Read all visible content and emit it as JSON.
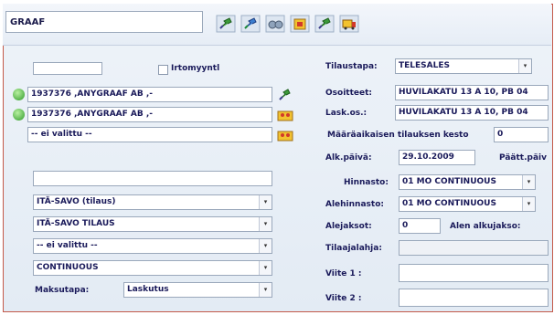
{
  "header": {
    "customer": "GRAAF",
    "toolbar_icons": [
      "pin-green-icon",
      "pin-blue-icon",
      "binoculars-icon",
      "folder-icon",
      "pin-green-2-icon",
      "truck-icon"
    ]
  },
  "left": {
    "top_field": "",
    "checkbox_label": "Irtomyyntl",
    "customer1": "1937376 ,ANYGRAAF AB ,-",
    "customer2": "1937376 ,ANYGRAAF AB ,-",
    "customer3": "-- ei valittu --",
    "blank_field": "",
    "select1": "ITÄ-SAVO (tilaus)",
    "select2": "ITÄ-SAVO TILAUS",
    "select3": "-- ei valittu --",
    "select4": "CONTINUOUS",
    "payment_label": "Maksutapa:",
    "payment_value": "Laskutus"
  },
  "right": {
    "tilaustapa_label": "Tilaustapa:",
    "tilaustapa_value": "TELESALES",
    "osoitteet_label": "Osoitteet:",
    "osoitteet_value": "HUVILAKATU 13 A 10, PB 04",
    "laskau_label": "Lask.os.:",
    "laskau_value": "HUVILAKATU 13 A 10, PB 04",
    "kesto_label": "Määräaikaisen tilauksen kesto",
    "kesto_value": "0",
    "alkupaiva_label": "Alk.päivä:",
    "alkupaiva_value": "29.10.2009",
    "paatt_label": "Päätt.päiv",
    "hinnasto_label": "Hinnasto:",
    "hinnasto_value": "01 MO CONTINUOUS",
    "alehinnasto_label": "Alehinnasto:",
    "alehinnasto_value": "01 MO CONTINUOUS",
    "alejaksot_label": "Alejaksot:",
    "alejaksot_value": "0",
    "alen_label": "Alen alkujakso:",
    "tilaajalahja_label": "Tilaajalahja:",
    "tilaajalahja_value": "",
    "viite1_label": "Viite 1 :",
    "viite1_value": "",
    "viite2_label": "Viite 2 :",
    "viite2_value": ""
  }
}
